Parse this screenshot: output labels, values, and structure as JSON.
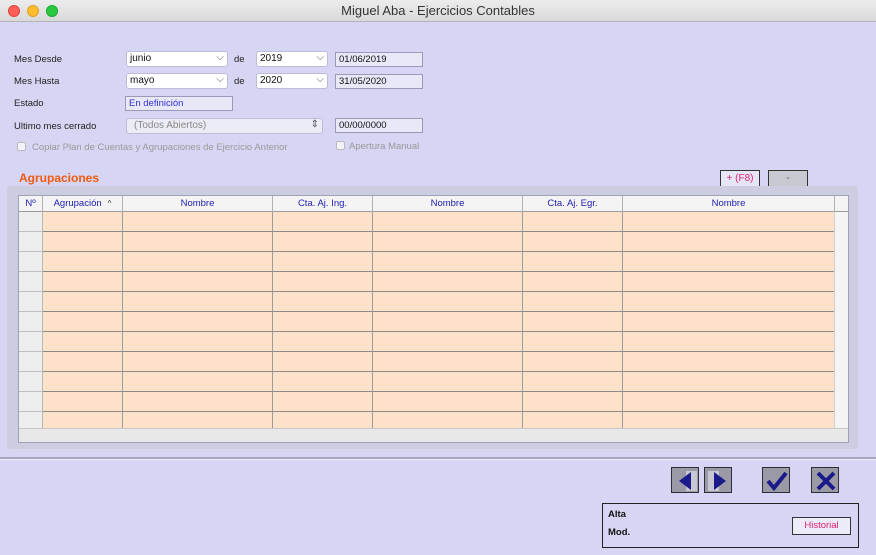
{
  "window": {
    "title": "Miguel Aba - Ejercicios Contables"
  },
  "form": {
    "mes_desde": {
      "label": "Mes Desde",
      "month": "junio",
      "de": "de",
      "year": "2019",
      "date": "01/06/2019"
    },
    "mes_hasta": {
      "label": "Mes Hasta",
      "month": "mayo",
      "de": "de",
      "year": "2020",
      "date": "31/05/2020"
    },
    "estado": {
      "label": "Estado",
      "value": "En definición"
    },
    "ultimo_mes": {
      "label": "Ultimo mes cerrado",
      "value": "(Todos Abiertos)",
      "date": "00/00/0000"
    },
    "copiar_plan": {
      "label": "Copiar Plan de Cuentas y Agrupaciones de Ejercicio Anterior",
      "checked": false
    },
    "apertura_manual": {
      "label": "Apertura Manual",
      "checked": false
    }
  },
  "agrupaciones": {
    "title": "Agrupaciones",
    "add_label": "+ (F8)",
    "remove_label": "-",
    "columns": [
      "Nº",
      "Agrupación",
      "Nombre",
      "Cta. Aj. Ing.",
      "Nombre",
      "Cta. Aj. Egr.",
      "Nombre"
    ],
    "sort_indicator": "^",
    "row_count": 11
  },
  "footer": {
    "icons": [
      "prev-arrow-icon",
      "next-arrow-icon",
      "checkmark-icon",
      "close-x-icon"
    ],
    "alta_label": "Alta",
    "mod_label": "Mod.",
    "historial_label": "Historial"
  },
  "colors": {
    "background": "#d6d6f4",
    "section_title": "#f05a0e",
    "row_fill": "#fde1c8",
    "header_text": "#2020b0",
    "accent_button_text": "#e02070"
  }
}
